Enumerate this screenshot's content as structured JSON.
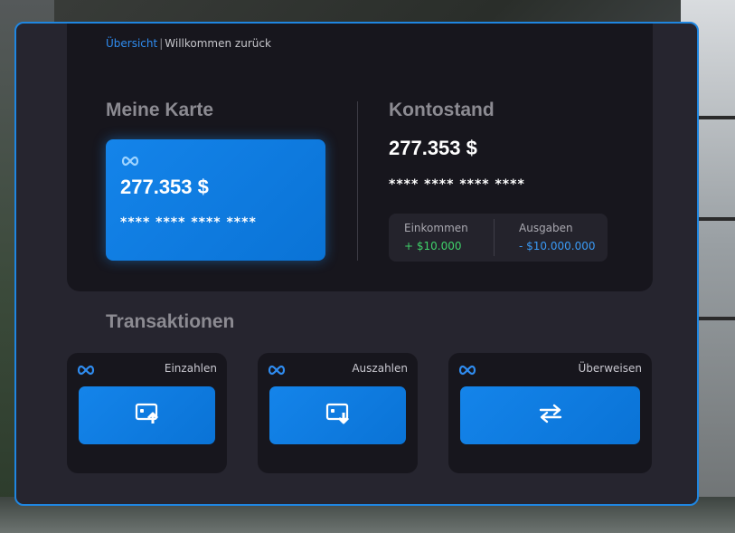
{
  "breadcrumb": {
    "active": "Übersicht",
    "separator": "|",
    "rest": "Willkommen zurück"
  },
  "my_card": {
    "title": "Meine Karte",
    "logo": "infinity-icon",
    "amount": "277.353 $",
    "number": "**** **** **** ****"
  },
  "balance": {
    "title": "Kontostand",
    "amount": "277.353 $",
    "number": "**** **** **** ****",
    "income_label": "Einkommen",
    "income_value": "+ $10.000",
    "expense_label": "Ausgaben",
    "expense_value": "- $10.000.000"
  },
  "transactions": {
    "title": "Transaktionen",
    "items": [
      {
        "label": "Einzahlen",
        "icon": "deposit-icon"
      },
      {
        "label": "Auszahlen",
        "icon": "withdraw-icon"
      },
      {
        "label": "Überweisen",
        "icon": "transfer-icon"
      }
    ]
  },
  "colors": {
    "accent": "#1f86e0",
    "card": "#0a73d6",
    "income": "#3fd26a",
    "expense": "#3a9af5",
    "panel": "#17161d",
    "background": "#26252f"
  }
}
